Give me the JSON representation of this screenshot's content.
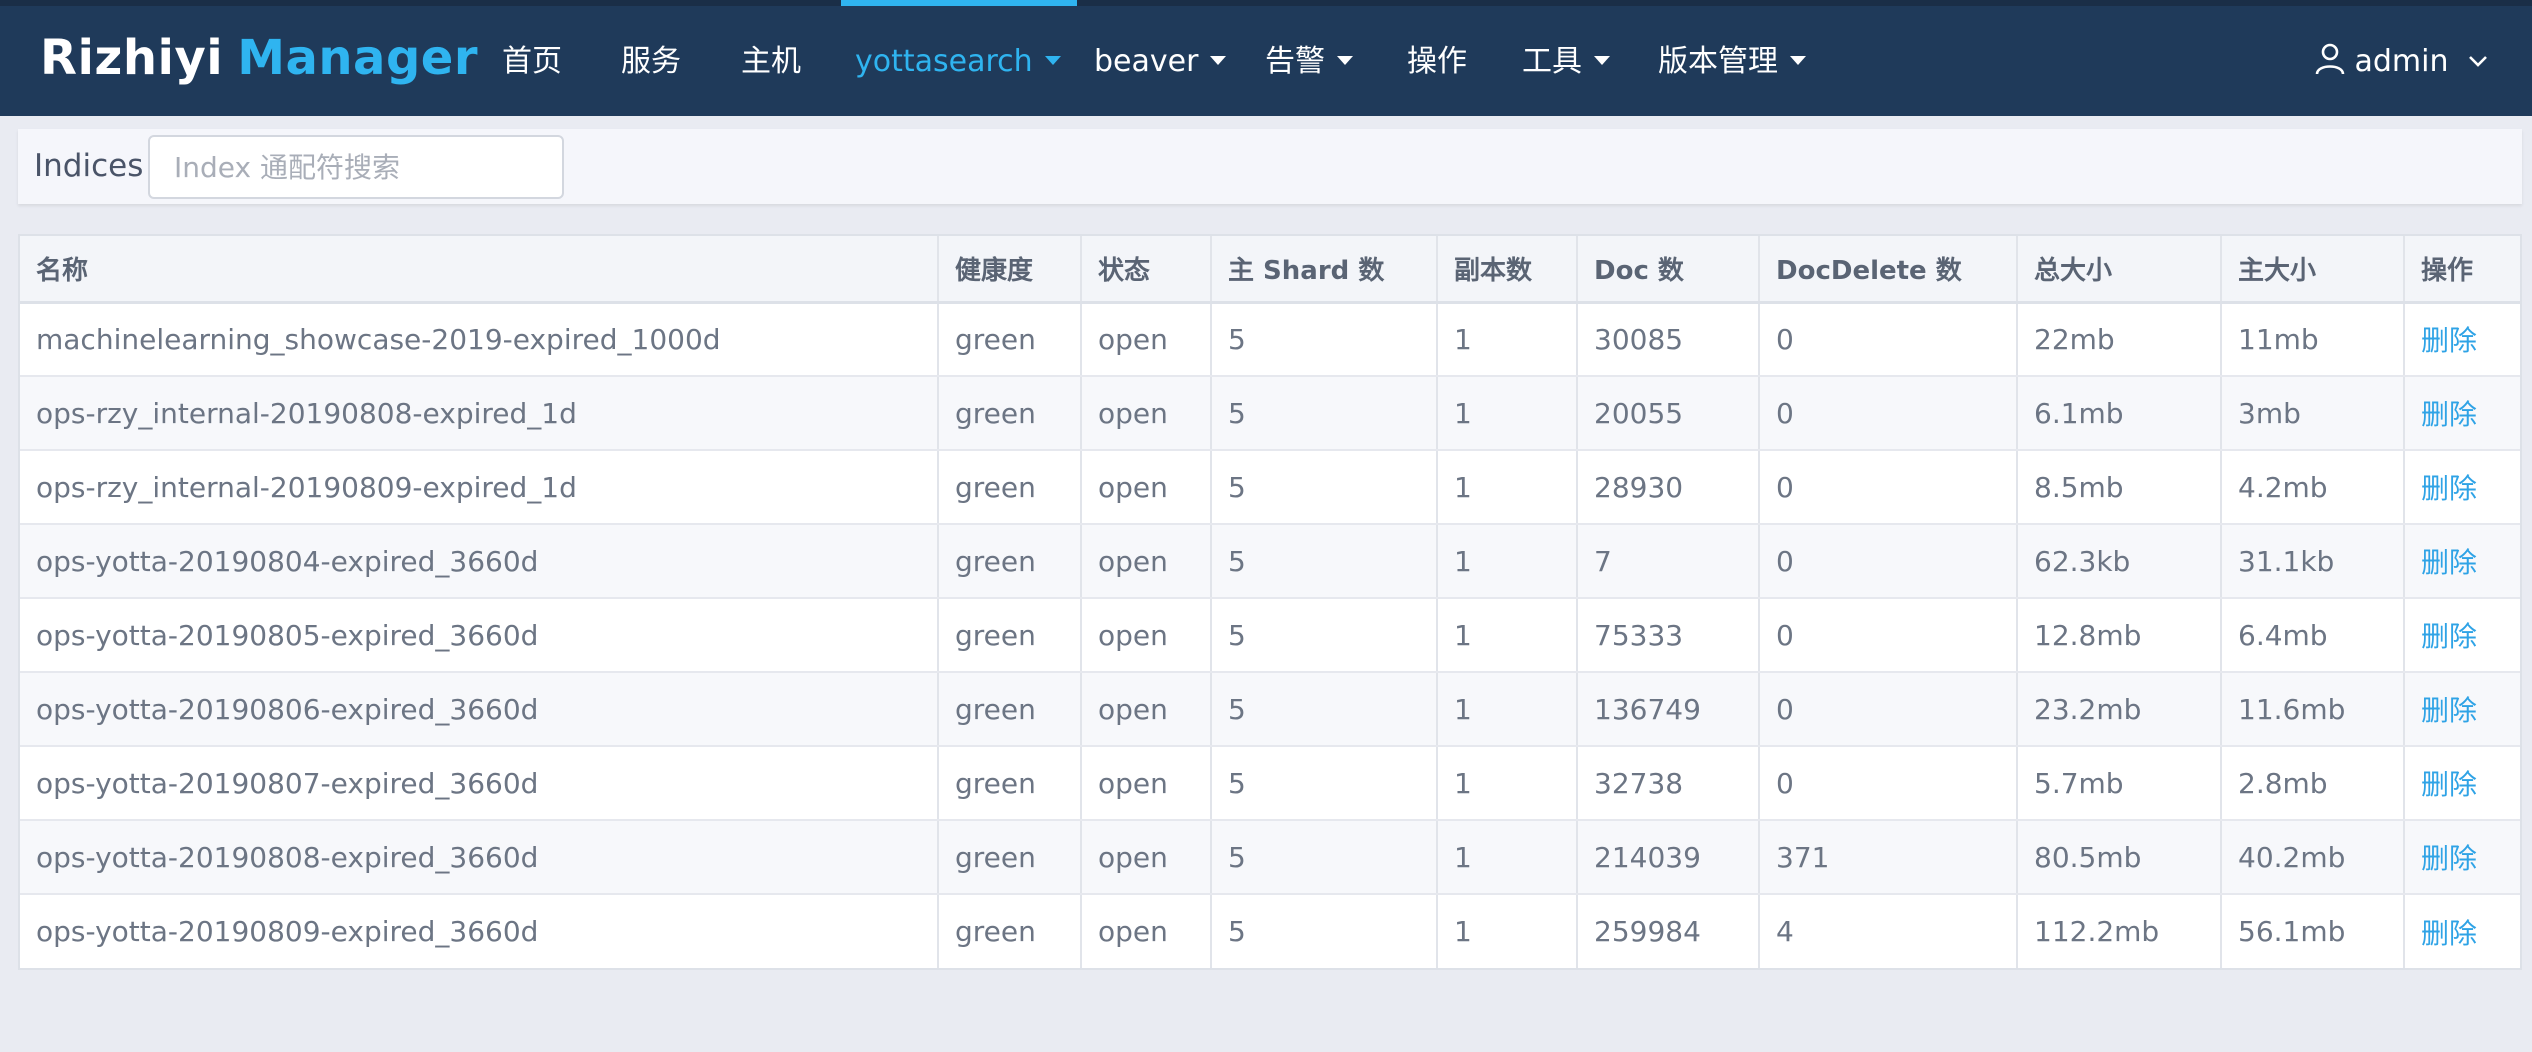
{
  "app": {
    "brand_a": "Rizhiyi",
    "brand_b": "Manager",
    "colors": {
      "nav_bg": "#1f3a5a",
      "accent": "#2fb4f0",
      "link": "#2fa3e6"
    }
  },
  "nav": {
    "items": [
      {
        "label": "首页",
        "dropdown": false,
        "active": false
      },
      {
        "label": "服务",
        "dropdown": false,
        "active": false
      },
      {
        "label": "主机",
        "dropdown": false,
        "active": false
      },
      {
        "label": "yottasearch",
        "dropdown": true,
        "active": true
      },
      {
        "label": "beaver",
        "dropdown": true,
        "active": false
      },
      {
        "label": "告警",
        "dropdown": true,
        "active": false
      },
      {
        "label": "操作",
        "dropdown": false,
        "active": false
      },
      {
        "label": "工具",
        "dropdown": true,
        "active": false
      },
      {
        "label": "版本管理",
        "dropdown": true,
        "active": false
      }
    ],
    "user": {
      "name": "admin",
      "icon": "user-icon"
    }
  },
  "filter": {
    "label": "Indices",
    "placeholder": "Index 通配符搜索",
    "value": ""
  },
  "table": {
    "columns": [
      "名称",
      "健康度",
      "状态",
      "主 Shard 数",
      "副本数",
      "Doc 数",
      "DocDelete 数",
      "总大小",
      "主大小",
      "操作"
    ],
    "rows": [
      [
        "machinelearning_showcase-2019-expired_1000d",
        "green",
        "open",
        "5",
        "1",
        "30085",
        "0",
        "22mb",
        "11mb",
        "删除"
      ],
      [
        "ops-rzy_internal-20190808-expired_1d",
        "green",
        "open",
        "5",
        "1",
        "20055",
        "0",
        "6.1mb",
        "3mb",
        "删除"
      ],
      [
        "ops-rzy_internal-20190809-expired_1d",
        "green",
        "open",
        "5",
        "1",
        "28930",
        "0",
        "8.5mb",
        "4.2mb",
        "删除"
      ],
      [
        "ops-yotta-20190804-expired_3660d",
        "green",
        "open",
        "5",
        "1",
        "7",
        "0",
        "62.3kb",
        "31.1kb",
        "删除"
      ],
      [
        "ops-yotta-20190805-expired_3660d",
        "green",
        "open",
        "5",
        "1",
        "75333",
        "0",
        "12.8mb",
        "6.4mb",
        "删除"
      ],
      [
        "ops-yotta-20190806-expired_3660d",
        "green",
        "open",
        "5",
        "1",
        "136749",
        "0",
        "23.2mb",
        "11.6mb",
        "删除"
      ],
      [
        "ops-yotta-20190807-expired_3660d",
        "green",
        "open",
        "5",
        "1",
        "32738",
        "0",
        "5.7mb",
        "2.8mb",
        "删除"
      ],
      [
        "ops-yotta-20190808-expired_3660d",
        "green",
        "open",
        "5",
        "1",
        "214039",
        "371",
        "80.5mb",
        "40.2mb",
        "删除"
      ],
      [
        "ops-yotta-20190809-expired_3660d",
        "green",
        "open",
        "5",
        "1",
        "259984",
        "4",
        "112.2mb",
        "56.1mb",
        "删除"
      ]
    ]
  }
}
